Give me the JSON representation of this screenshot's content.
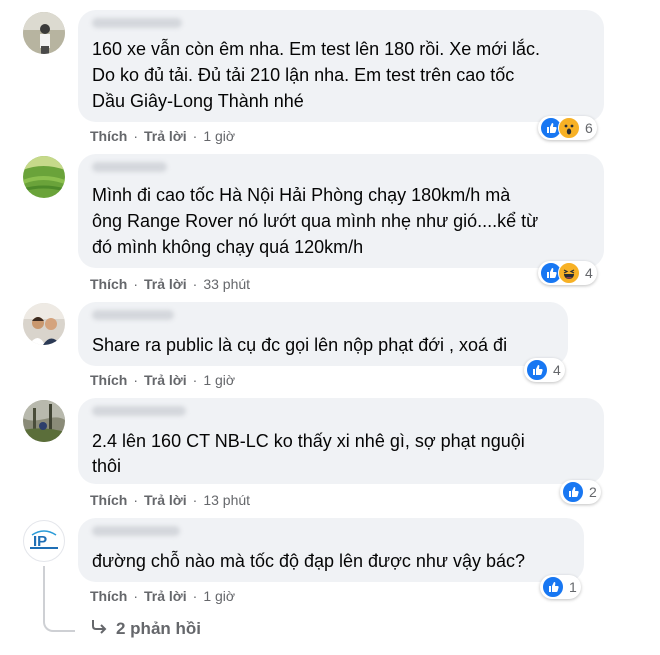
{
  "comments": [
    {
      "text": [
        "160 xe vẫn còn êm nha. Em test lên 180 rồi. Xe mới lắc.",
        "Do ko đủ tải. Đủ tải 210 lận nha. Em test trên cao tốc",
        "Dầu Giây-Long Thành nhé"
      ],
      "like_label": "Thích",
      "reply_label": "Trả lời",
      "time": "1 giờ",
      "reaction_count": "6",
      "reactions": [
        "like-icon",
        "wow-icon"
      ]
    },
    {
      "text": [
        "Mình đi cao tốc Hà Nội Hải Phòng chạy 180km/h mà",
        "ông Range Rover nó lướt qua mình nhẹ như gió....kể từ",
        "đó mình không chạy quá 120km/h"
      ],
      "like_label": "Thích",
      "reply_label": "Trả lời",
      "time": "33 phút",
      "reaction_count": "4",
      "reactions": [
        "like-icon",
        "haha-icon"
      ]
    },
    {
      "text": [
        "Share ra public là cụ đc gọi lên nộp phạt đới , xoá đi"
      ],
      "like_label": "Thích",
      "reply_label": "Trả lời",
      "time": "1 giờ",
      "reaction_count": "4",
      "reactions": [
        "like-icon"
      ]
    },
    {
      "text": [
        "2.4 lên 160 CT NB-LC ko thấy xi nhê gì, sợ phạt nguội",
        "thôi"
      ],
      "like_label": "Thích",
      "reply_label": "Trả lời",
      "time": "13 phút",
      "reaction_count": "2",
      "reactions": [
        "like-icon"
      ]
    },
    {
      "text": [
        "đường chỗ nào mà tốc độ đạp lên được như vậy bác?"
      ],
      "like_label": "Thích",
      "reply_label": "Trả lời",
      "time": "1 giờ",
      "reaction_count": "1",
      "reactions": [
        "like-icon"
      ]
    }
  ],
  "replies_link": "2 phản hồi",
  "colors": {
    "bubble": "#f0f2f5",
    "like_blue": "#1877f2",
    "meta_gray": "#65676b",
    "emoji_yellow": "#f7b125"
  }
}
